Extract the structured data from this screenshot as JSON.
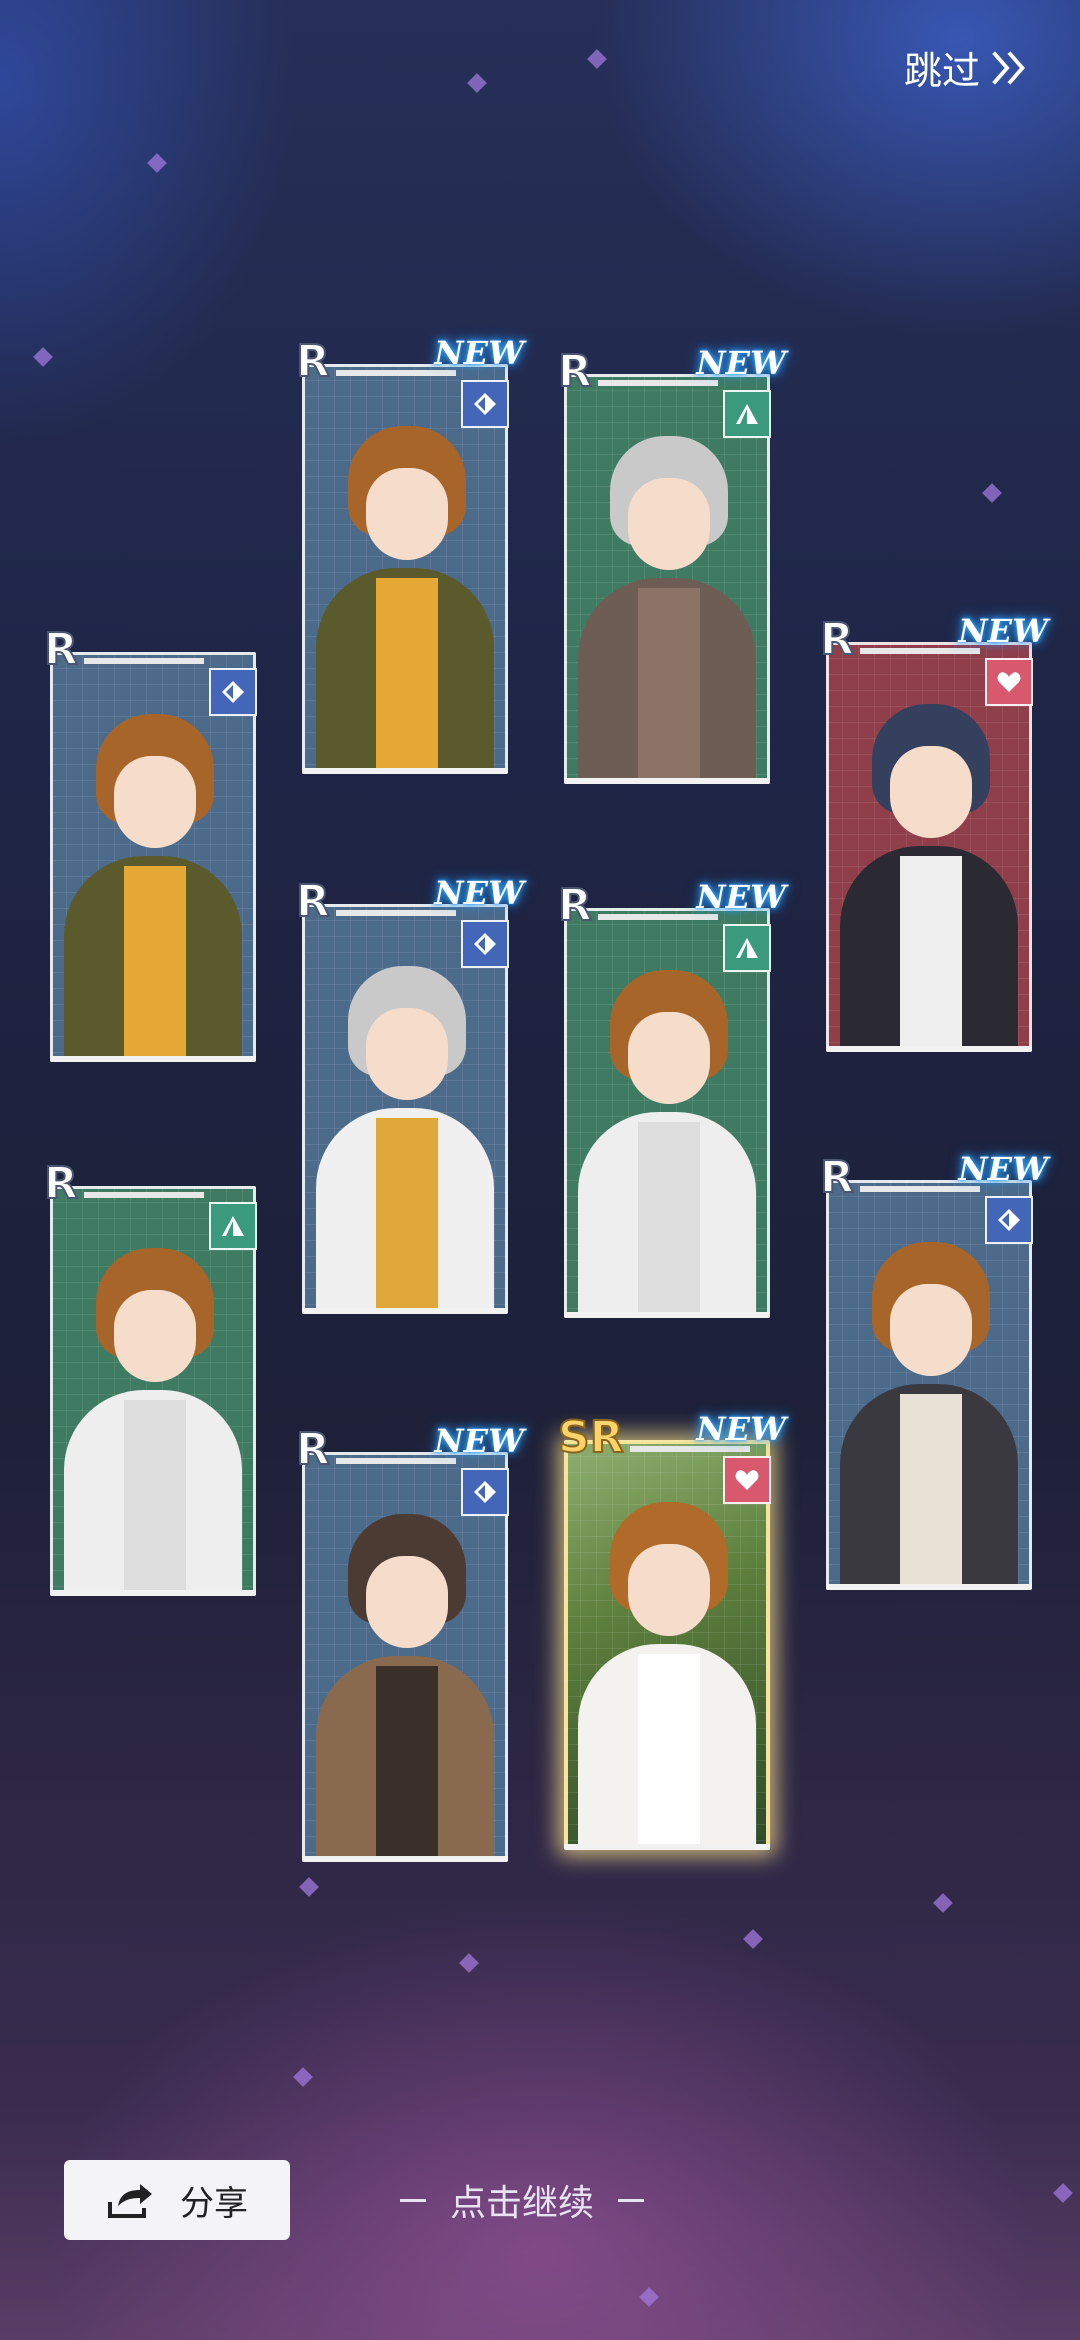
{
  "header": {
    "skip_label": "跳过"
  },
  "cards": [
    {
      "rarity": "R",
      "new": "",
      "type_icon": "wit-icon",
      "bg": "#4c6a8a",
      "hair": "#a8652a",
      "outfit": "#5a5a2c",
      "inner": "#e6a936"
    },
    {
      "rarity": "R",
      "new": "NEW",
      "type_icon": "wit-icon",
      "bg": "#4c6a8a",
      "hair": "#a8652a",
      "outfit": "#5a5a2c",
      "inner": "#e6a936"
    },
    {
      "rarity": "R",
      "new": "NEW",
      "type_icon": "tri-icon",
      "bg": "#3f7b63",
      "hair": "#c9c9c9",
      "outfit": "#6e5d55",
      "inner": "#8b7368"
    },
    {
      "rarity": "R",
      "new": "NEW",
      "type_icon": "heart-icon",
      "bg": "#8f3e4a",
      "hair": "#34405e",
      "outfit": "#2b2a33",
      "inner": "#efefef"
    },
    {
      "rarity": "R",
      "new": "NEW",
      "type_icon": "wit-icon",
      "bg": "#4c6a8a",
      "hair": "#c9c9c9",
      "outfit": "#f0f0f0",
      "inner": "#e0a838"
    },
    {
      "rarity": "R",
      "new": "NEW",
      "type_icon": "tri-icon",
      "bg": "#3f7b63",
      "hair": "#a8652a",
      "outfit": "#eeeeee",
      "inner": "#dddddd"
    },
    {
      "rarity": "R",
      "new": "",
      "type_icon": "tri-icon",
      "bg": "#3f7b63",
      "hair": "#a8652a",
      "outfit": "#eeeeee",
      "inner": "#dddddd"
    },
    {
      "rarity": "R",
      "new": "NEW",
      "type_icon": "wit-icon",
      "bg": "#4c6a8a",
      "hair": "#a8652a",
      "outfit": "#3b3940",
      "inner": "#e9e1d6"
    },
    {
      "rarity": "R",
      "new": "NEW",
      "type_icon": "wit-icon",
      "bg": "#4c6a8a",
      "hair": "#4c3b33",
      "outfit": "#8a6a4e",
      "inner": "#3b2f2a"
    },
    {
      "rarity": "SR",
      "new": "NEW",
      "type_icon": "heart-icon",
      "bg": "#5d7f3c",
      "hair": "#b06a2a",
      "outfit": "#f4f2ee",
      "inner": "#ffffff"
    }
  ],
  "footer": {
    "share_label": "分享",
    "continue_label": "点击继续"
  }
}
